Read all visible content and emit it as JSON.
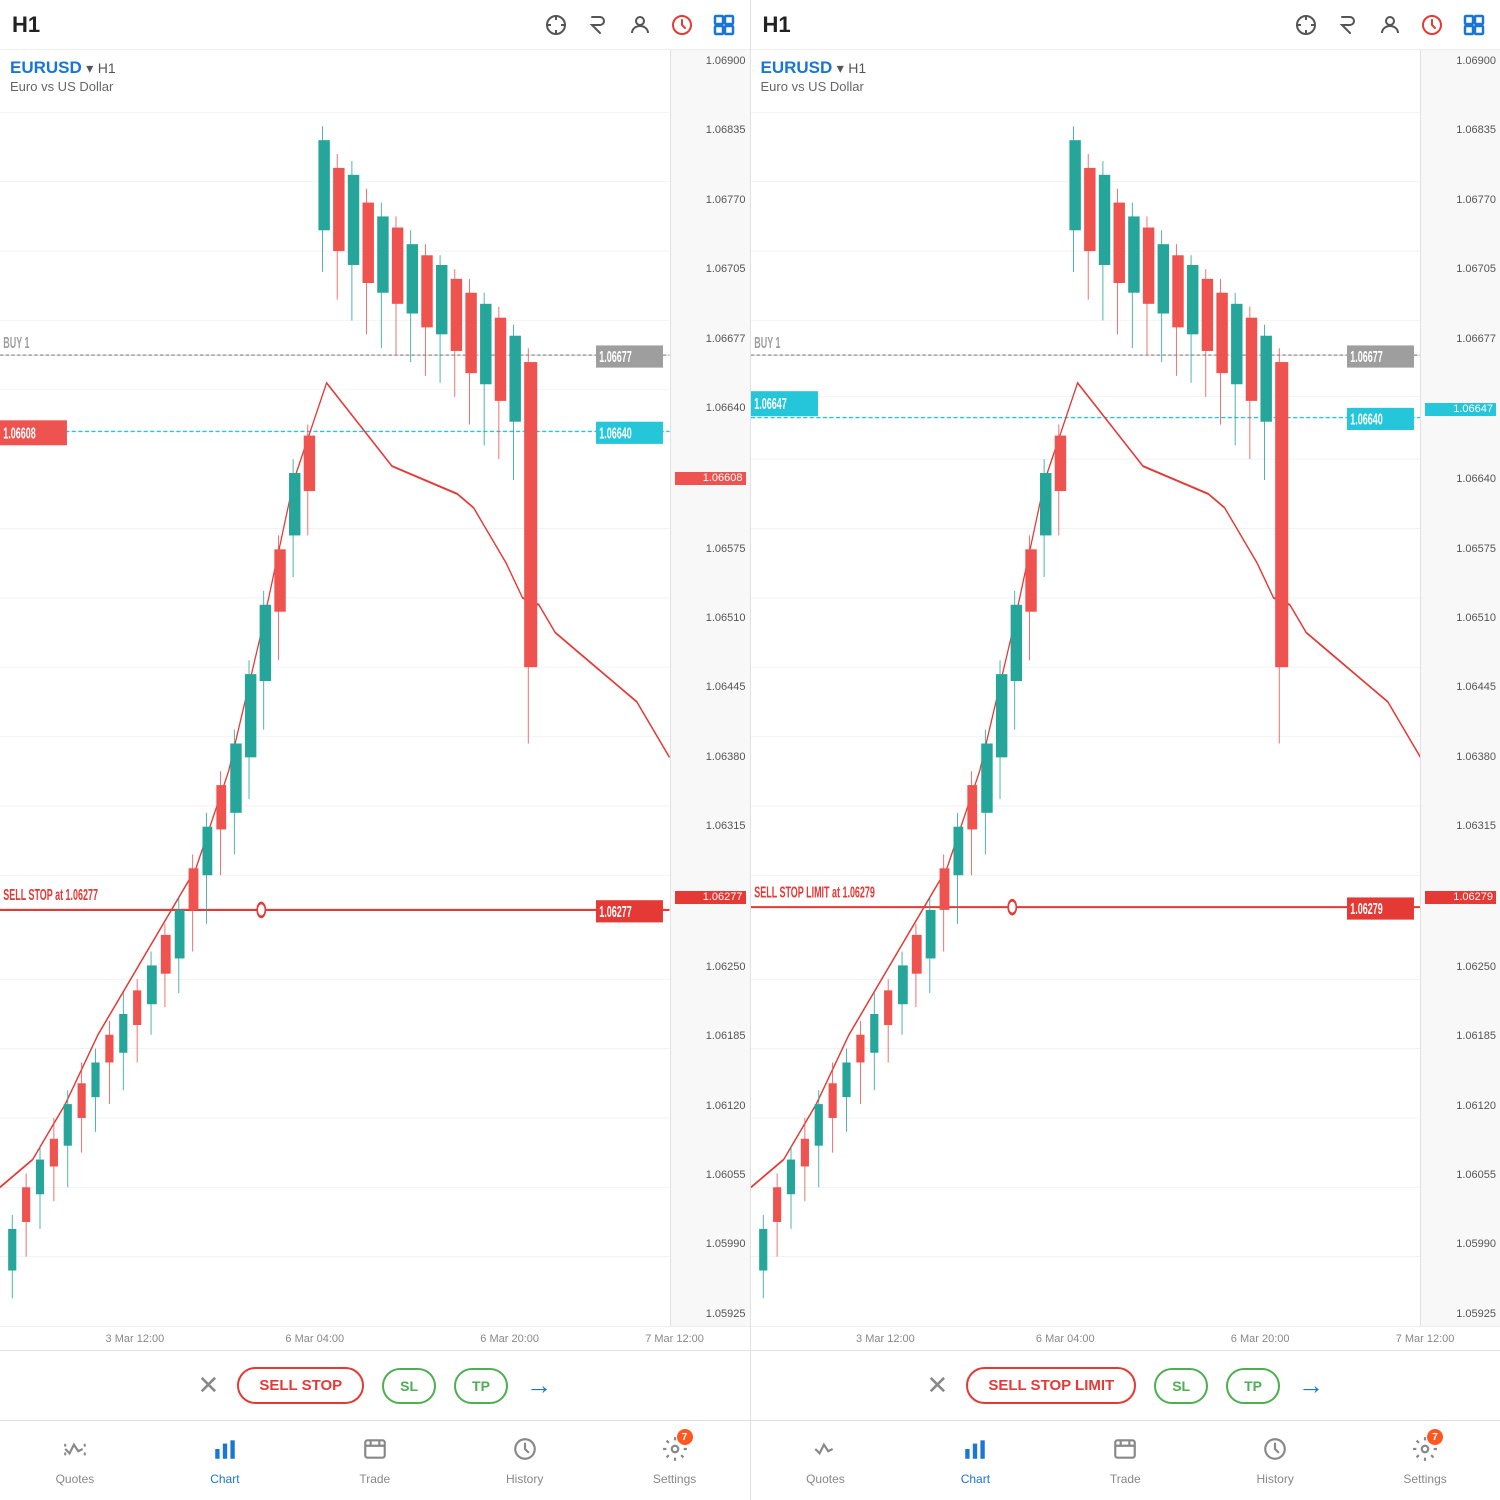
{
  "panels": [
    {
      "id": "left",
      "timeframe": "H1",
      "symbol": "EURUSD",
      "arrow": "▾",
      "tf_label": "H1",
      "description": "Euro vs US Dollar",
      "price_levels": [
        "1.06900",
        "1.06835",
        "1.06770",
        "1.06705",
        "1.06677",
        "1.06640",
        "1.06608",
        "1.06575",
        "1.06510",
        "1.06445",
        "1.06380",
        "1.06315",
        "1.06277",
        "1.06250",
        "1.06185",
        "1.06120",
        "1.06055",
        "1.05990",
        "1.05925"
      ],
      "order_type": "SELL STOP",
      "order_price": "1.06277",
      "buy1_label": "BUY 1",
      "buy1_price": "1.06677",
      "current_price": "1.06608",
      "dashed_price": "1.06640",
      "time_labels": [
        "3 Mar 12:00",
        "6 Mar 04:00",
        "6 Mar 20:00",
        "7 Mar 12:00"
      ],
      "action_order_label": "SELL STOP",
      "action_sl_label": "SL",
      "action_tp_label": "TP"
    },
    {
      "id": "right",
      "timeframe": "H1",
      "symbol": "EURUSD",
      "arrow": "▾",
      "tf_label": "H1",
      "description": "Euro vs US Dollar",
      "price_levels": [
        "1.06900",
        "1.06835",
        "1.06770",
        "1.06705",
        "1.06677",
        "1.06647",
        "1.06640",
        "1.06575",
        "1.06510",
        "1.06445",
        "1.06380",
        "1.06315",
        "1.06279",
        "1.06250",
        "1.06185",
        "1.06120",
        "1.06055",
        "1.05990",
        "1.05925"
      ],
      "order_type": "SELL STOP LIMIT",
      "order_price": "1.06279",
      "buy1_label": "BUY 1",
      "buy1_price": "1.06677",
      "current_price": "1.06647",
      "dashed_price": "1.06640",
      "time_labels": [
        "3 Mar 12:00",
        "6 Mar 04:00",
        "6 Mar 20:00",
        "7 Mar 12:00"
      ],
      "action_order_label": "SELL STOP LIMIT",
      "action_sl_label": "SL",
      "action_tp_label": "TP"
    }
  ],
  "nav": {
    "left": [
      {
        "id": "quotes",
        "label": "Quotes",
        "active": false
      },
      {
        "id": "chart",
        "label": "Chart",
        "active": true
      },
      {
        "id": "trade",
        "label": "Trade",
        "active": false
      },
      {
        "id": "history",
        "label": "History",
        "active": false
      },
      {
        "id": "settings",
        "label": "Settings",
        "active": false,
        "badge": "7"
      }
    ],
    "right": [
      {
        "id": "quotes",
        "label": "Quotes",
        "active": false
      },
      {
        "id": "chart",
        "label": "Chart",
        "active": true
      },
      {
        "id": "trade",
        "label": "Trade",
        "active": false
      },
      {
        "id": "history",
        "label": "History",
        "active": false
      },
      {
        "id": "settings",
        "label": "Settings",
        "active": false,
        "badge": "7"
      }
    ]
  },
  "colors": {
    "bull": "#26a69a",
    "bear": "#ef5350",
    "order_red": "#e53935",
    "buy_gray": "#9e9e9e",
    "dashed_teal": "#26c6da",
    "current_price_bg": "#ef5350",
    "active_blue": "#1976d2"
  }
}
